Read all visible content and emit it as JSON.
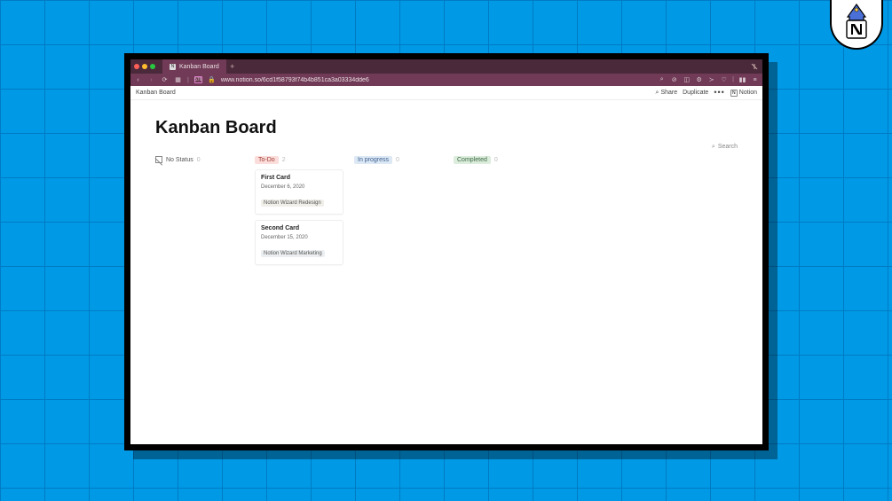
{
  "backdrop": {
    "color": "#0099e5",
    "grid_color": "#007bc4"
  },
  "browser": {
    "tab": {
      "title": "Kanban Board"
    },
    "url": "www.notion.so/6cd1f58793f74b4b851ca3a03334dde6"
  },
  "notion": {
    "breadcrumb": "Kanban Board",
    "actions": {
      "share_label": "Share",
      "duplicate_label": "Duplicate",
      "notion_label": "Notion"
    }
  },
  "page": {
    "title": "Kanban Board",
    "search_label": "Search"
  },
  "board": {
    "columns": [
      {
        "id": "nostatus",
        "label": "No Status",
        "count": "0",
        "style": "plain",
        "icon": "empty-box"
      },
      {
        "id": "todo",
        "label": "To-Do",
        "count": "2",
        "style": "red"
      },
      {
        "id": "inprogress",
        "label": "In progress",
        "count": "0",
        "style": "blue"
      },
      {
        "id": "completed",
        "label": "Completed",
        "count": "0",
        "style": "green"
      }
    ],
    "cards": {
      "todo": [
        {
          "title": "First Card",
          "date": "December 6, 2020",
          "chip": "Notion Wizard Redesign"
        },
        {
          "title": "Second Card",
          "date": "December 15, 2020",
          "chip": "Notion Wizard Marketing"
        }
      ]
    }
  }
}
